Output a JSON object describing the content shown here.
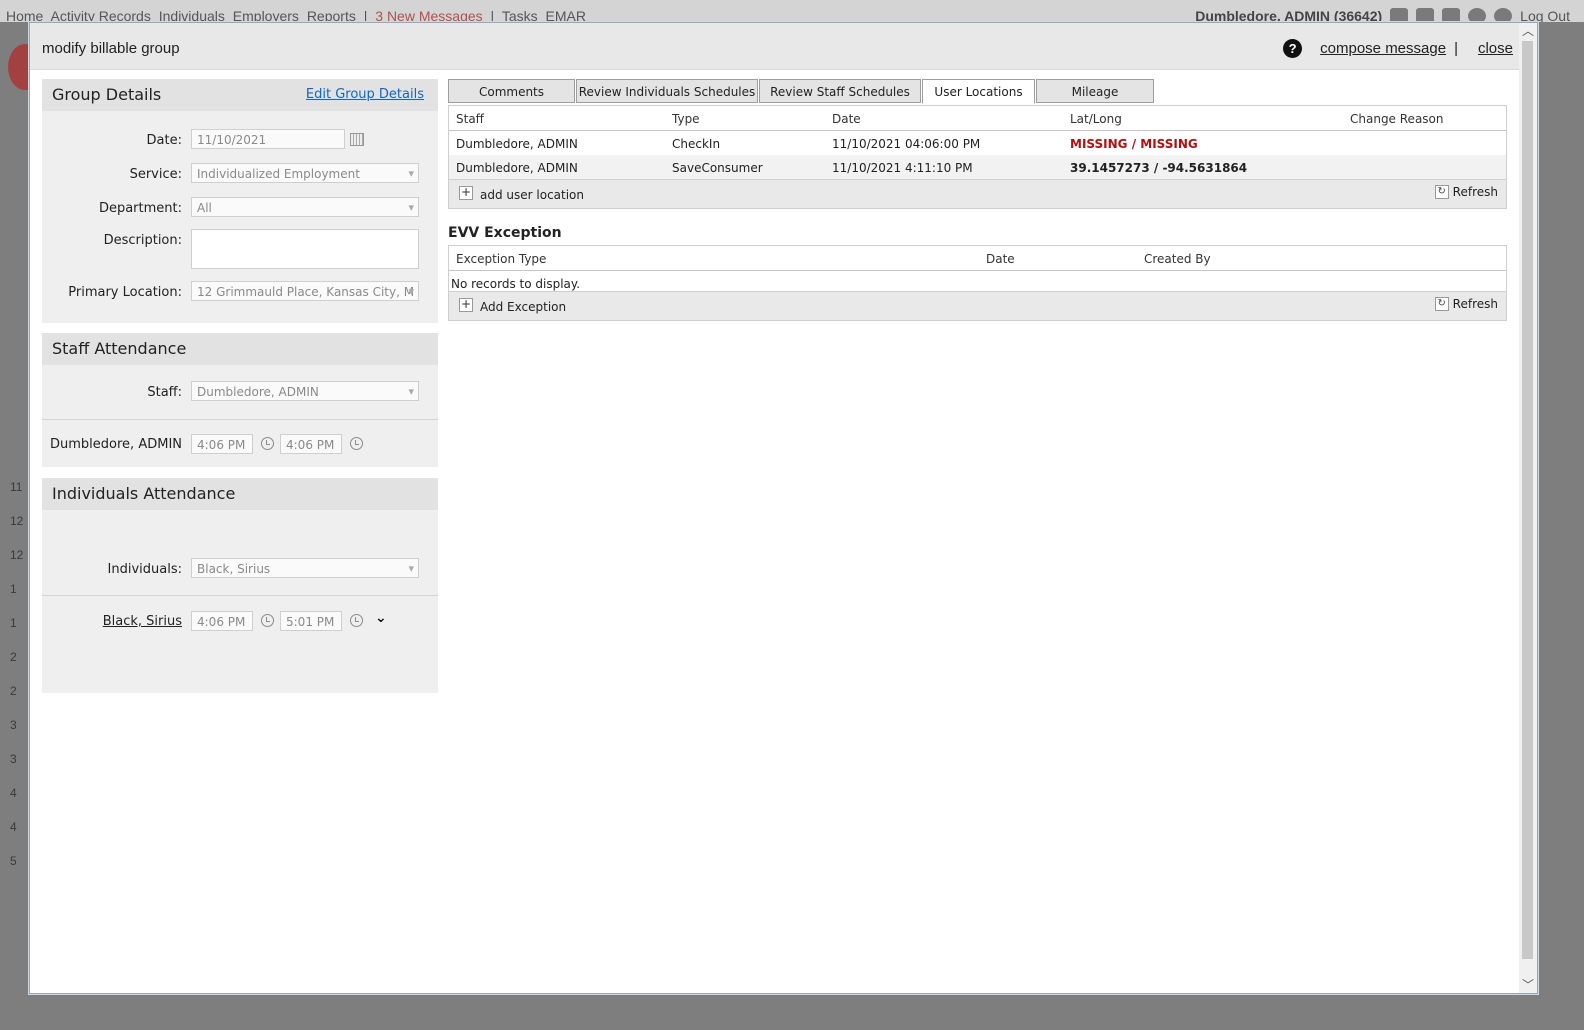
{
  "app_nav": {
    "items": [
      "Home",
      "Activity Records",
      "Individuals",
      "Employers",
      "Reports",
      "|",
      "3 New Messages",
      "|",
      "Tasks",
      "EMAR"
    ],
    "user": "Dumbledore, ADMIN (36642)",
    "logout": "Log Out",
    "icons": [
      "home-icon",
      "people-icon",
      "box-icon",
      "help-icon",
      "gear-icon"
    ],
    "side_numbers": [
      "11",
      "12",
      "12",
      "1",
      "1",
      "2",
      "2",
      "3",
      "3",
      "4",
      "4",
      "5"
    ]
  },
  "modal": {
    "title": "modify billable group",
    "compose": "compose message",
    "separator": "|",
    "close": "close",
    "help_glyph": "?"
  },
  "group_details": {
    "heading": "Group Details",
    "edit_link": "Edit Group Details",
    "date_label": "Date:",
    "date_value": "11/10/2021",
    "service_label": "Service:",
    "service_value": "Individualized Employment",
    "department_label": "Department:",
    "department_value": "All",
    "description_label": "Description:",
    "description_value": "",
    "location_label": "Primary Location:",
    "location_value": "12 Grimmauld Place, Kansas City, M"
  },
  "staff_attendance": {
    "heading": "Staff Attendance",
    "staff_label": "Staff:",
    "staff_value": "Dumbledore, ADMIN",
    "person": "Dumbledore, ADMIN",
    "start": "4:06 PM",
    "end": "4:06 PM"
  },
  "individuals_attendance": {
    "heading": "Individuals Attendance",
    "individuals_label": "Individuals:",
    "individuals_value": "Black, Sirius",
    "person": "Black, Sirius",
    "start": "4:06 PM",
    "end": "5:01 PM"
  },
  "tabs": [
    {
      "label": "Comments"
    },
    {
      "label": "Review Individuals Schedules"
    },
    {
      "label": "Review Staff Schedules"
    },
    {
      "label": "User Locations"
    },
    {
      "label": "Mileage"
    }
  ],
  "user_locations": {
    "columns": [
      "Staff",
      "Type",
      "Date",
      "Lat/Long",
      "Change Reason"
    ],
    "rows": [
      {
        "staff": "Dumbledore, ADMIN",
        "type": "CheckIn",
        "date": "11/10/2021 04:06:00 PM",
        "latlong": "MISSING / MISSING",
        "reason": ""
      },
      {
        "staff": "Dumbledore, ADMIN",
        "type": "SaveConsumer",
        "date": "11/10/2021 4:11:10 PM",
        "latlong": "39.1457273 / -94.5631864",
        "reason": ""
      }
    ],
    "add_label": "add user location",
    "refresh_label": "Refresh"
  },
  "evv_exception": {
    "heading": "EVV Exception",
    "columns": [
      "Exception Type",
      "Date",
      "Created By"
    ],
    "empty_text": "No records to display.",
    "add_label": "Add Exception",
    "refresh_label": "Refresh"
  },
  "colors": {
    "missing": "#b01010",
    "link": "#1565c0",
    "messages": "#b05050"
  }
}
